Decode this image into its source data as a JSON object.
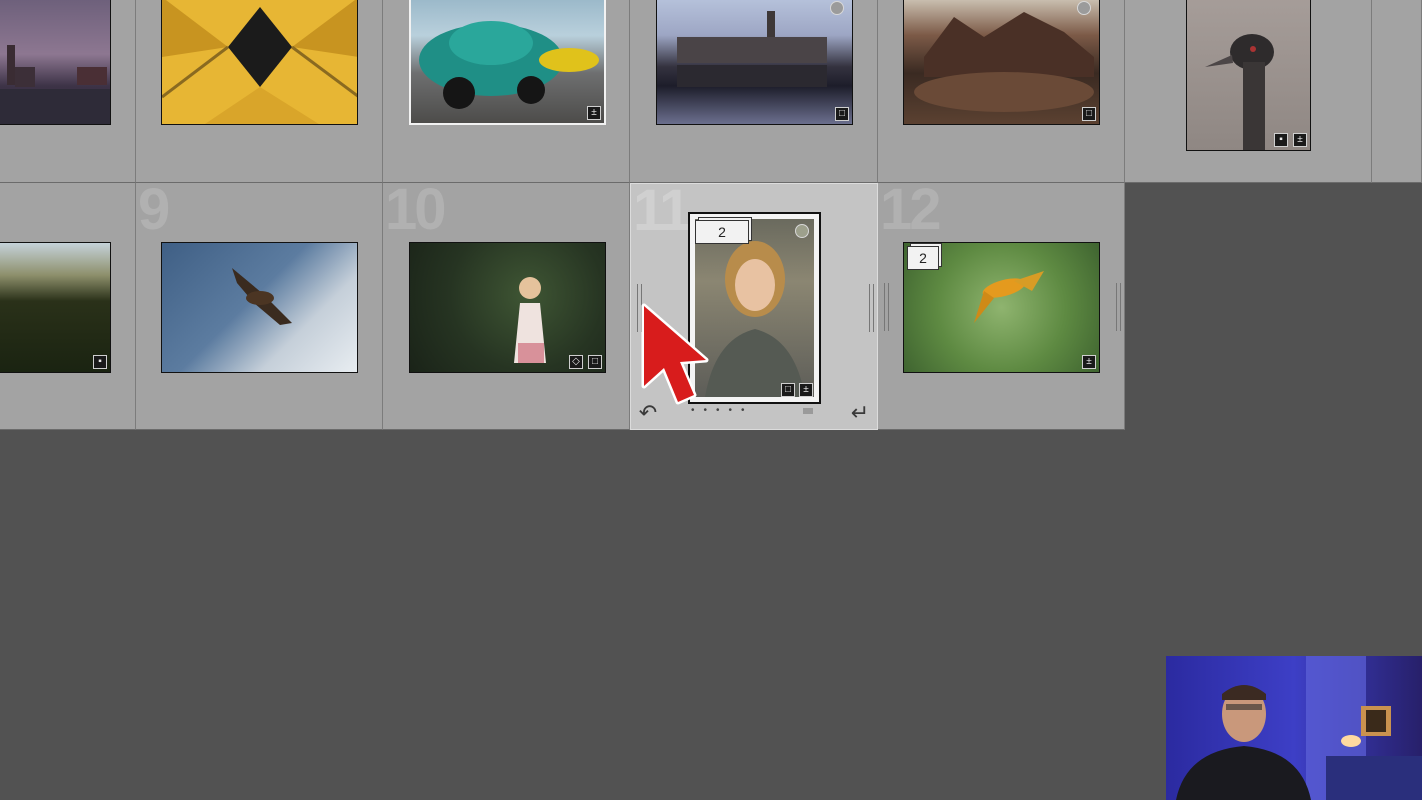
{
  "grid": {
    "row1": [
      {
        "scene": "city dusk waterfront"
      },
      {
        "scene": "yellow cube houses from below"
      },
      {
        "scene": "teal vintage beetle car"
      },
      {
        "scene": "river town reflection at dusk"
      },
      {
        "scene": "red rock formations"
      },
      {
        "scene": "emu portrait"
      }
    ],
    "row2": [
      {
        "number": "9"
      },
      {
        "number": "10"
      },
      {
        "number": "11"
      },
      {
        "number": "12"
      }
    ],
    "stack_count_selected": "2",
    "stack_count_parrot": "2"
  },
  "icons": {
    "rotate_left": "↶",
    "rotate_right": "↵",
    "comment": "comment-icon",
    "crop": "crop-icon",
    "develop": "develop-adjust-icon",
    "keyword": "keyword-tag-icon"
  },
  "colors": {
    "background": "#525252",
    "cell": "#a3a3a3",
    "cell_selected": "#c4c4c4",
    "cursor": "#d81c1c"
  }
}
